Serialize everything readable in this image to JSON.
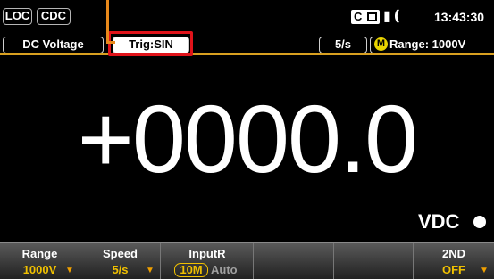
{
  "status_bar": {
    "loc": "LOC",
    "cdc": "CDC",
    "ce_label": "C",
    "speaker_icon": "speaker-icon",
    "time": "13:43:30"
  },
  "info_bar": {
    "function": "DC Voltage",
    "trigger": "Trig:SIN",
    "rate": "5/s",
    "range_badge": "M",
    "range": "Range: 1000V"
  },
  "display": {
    "reading": "+0000.0",
    "unit": "VDC"
  },
  "softkeys": [
    {
      "title": "Range",
      "value": "1000V"
    },
    {
      "title": "Speed",
      "value": "5/s"
    },
    {
      "title": "InputR",
      "selected": "10M",
      "alternative": "Auto"
    },
    {
      "title": "",
      "value": ""
    },
    {
      "title": "",
      "value": ""
    },
    {
      "title": "2ND",
      "value": "OFF"
    }
  ],
  "colors": {
    "annotation": "#e8891b",
    "highlight_frame": "#e0131a",
    "softkey_value": "#f0c000",
    "auto_badge": "#e9d400"
  }
}
